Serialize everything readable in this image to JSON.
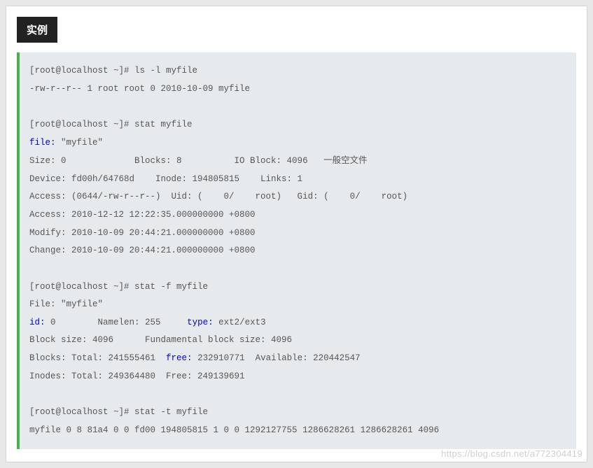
{
  "badge": "实例",
  "watermark": "https://blog.csdn.net/a772304419",
  "code": {
    "l01a": "[root@localhost ~]# ls -l myfile",
    "l02a": "-rw-r--r-- 1 root root 0 2010-10-09 myfile",
    "l03a": "",
    "l04a": "[root@localhost ~]# stat myfile",
    "l05_kw": "file:",
    "l05_rest": " \"myfile\"",
    "l06a": "Size: 0             Blocks: 8          IO Block: 4096   ",
    "l06_cjk": "一般空文件",
    "l07a": "Device: fd00h/64768d    Inode: 194805815    Links: 1",
    "l08a": "Access: (0644/-rw-r--r--)  Uid: (    0/    root)   Gid: (    0/    root)",
    "l09a": "Access: 2010-12-12 12:22:35.000000000 +0800",
    "l10a": "Modify: 2010-10-09 20:44:21.000000000 +0800",
    "l11a": "Change: 2010-10-09 20:44:21.000000000 +0800",
    "l12a": "",
    "l13a": "[root@localhost ~]# stat -f myfile",
    "l14a": "File: \"myfile\"",
    "l15_kw1": "id:",
    "l15_mid": " 0        Namelen: 255     ",
    "l15_kw2": "type:",
    "l15_end": " ext2/ext3",
    "l16a": "Block size: 4096      Fundamental block size: 4096",
    "l17_pre": "Blocks: Total: 241555461  ",
    "l17_kw": "free:",
    "l17_end": " 232910771  Available: 220442547",
    "l18a": "Inodes: Total: 249364480  Free: 249139691",
    "l19a": "",
    "l20a": "[root@localhost ~]# stat -t myfile",
    "l21a": "myfile 0 8 81a4 0 0 fd00 194805815 1 0 0 1292127755 1286628261 1286628261 4096"
  }
}
